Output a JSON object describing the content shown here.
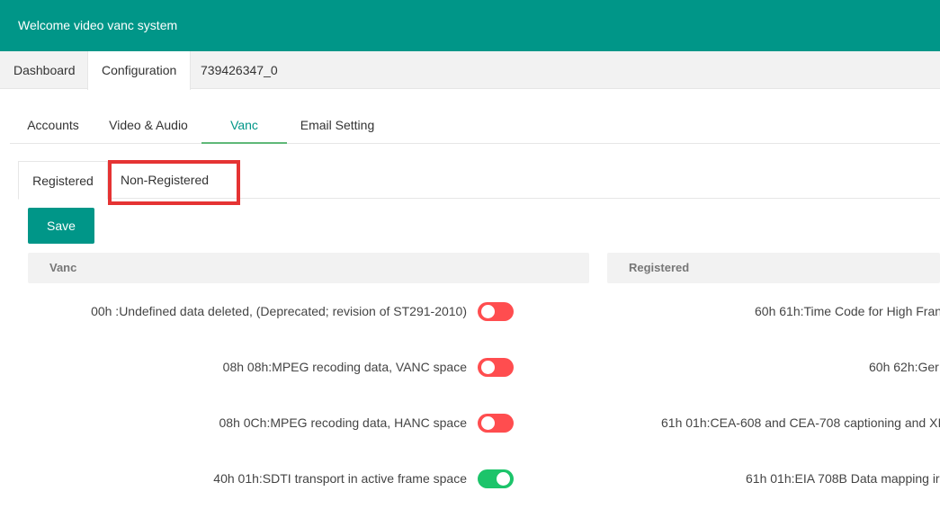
{
  "app": {
    "title": "Welcome video vanc system"
  },
  "main_tabs": [
    {
      "label": "Dashboard",
      "active": false
    },
    {
      "label": "Configuration",
      "active": true
    },
    {
      "label": "739426347_0",
      "active": false
    }
  ],
  "sub_tabs": [
    {
      "label": "Accounts",
      "active": false
    },
    {
      "label": "Video & Audio",
      "active": false
    },
    {
      "label": "Vanc",
      "active": true
    },
    {
      "label": "Email Setting",
      "active": false
    }
  ],
  "card_tabs": [
    {
      "label": "Registered",
      "active": true
    },
    {
      "label": "Non-Registered",
      "active": false,
      "highlighted": true
    }
  ],
  "highlight_color": "#e53333",
  "accent_color": "#009688",
  "save_label": "Save",
  "columns": {
    "left_header": "Vanc",
    "right_header": "Registered"
  },
  "left_rows": [
    {
      "label": "00h :Undefined data deleted, (Deprecated; revision of ST291-2010)",
      "enabled": false
    },
    {
      "label": "08h 08h:MPEG recoding data, VANC space",
      "enabled": false
    },
    {
      "label": "08h 0Ch:MPEG recoding data, HANC space",
      "enabled": false
    },
    {
      "label": "40h 01h:SDTI transport in active frame space",
      "enabled": true
    }
  ],
  "right_rows": [
    {
      "label": "60h 61h:Time Code for High Fran"
    },
    {
      "label": "60h 62h:Ger"
    },
    {
      "label": "61h 01h:CEA-608 and CEA-708 captioning and XI"
    },
    {
      "label": "61h 01h:EIA 708B Data mapping ir"
    }
  ],
  "toggle_colors": {
    "off": "#ff4d4f",
    "on": "#1cc46a"
  }
}
